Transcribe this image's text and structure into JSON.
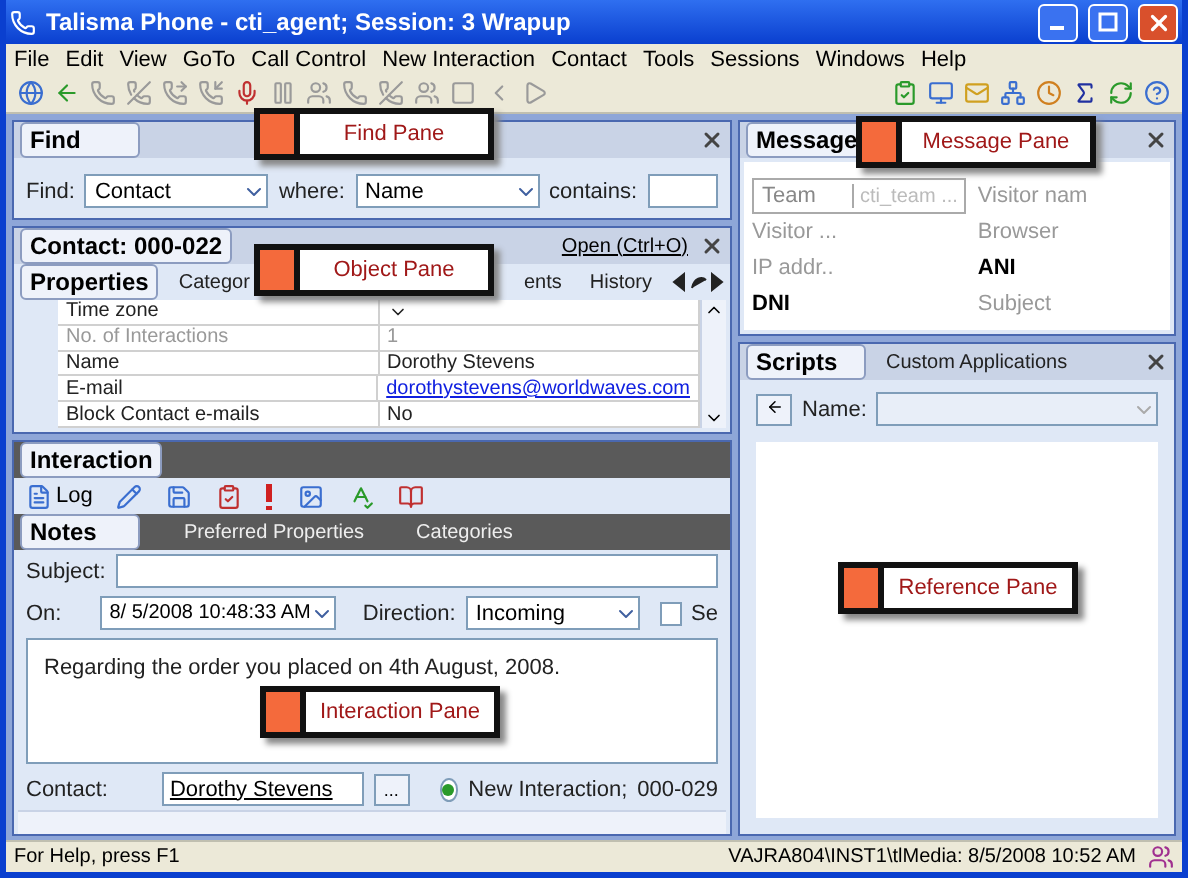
{
  "window": {
    "title": "Talisma Phone - cti_agent; Session: 3 Wrapup"
  },
  "menu": [
    "File",
    "Edit",
    "View",
    "GoTo",
    "Call Control",
    "New Interaction",
    "Contact",
    "Tools",
    "Sessions",
    "Windows",
    "Help"
  ],
  "find_pane": {
    "title": "Find",
    "find_label": "Find:",
    "find_value": "Contact",
    "where_label": "where:",
    "where_value": "Name",
    "contains_label": "contains:"
  },
  "object_pane": {
    "title": "Contact: 000-022",
    "open_link": "Open (Ctrl+O)",
    "tabs": [
      {
        "label": "Properties",
        "selected": true
      },
      {
        "label": "Categor",
        "selected": false
      },
      {
        "label": "ents",
        "selected": false
      },
      {
        "label": "History",
        "selected": false
      }
    ],
    "rows": [
      {
        "name": "Time zone",
        "value": "",
        "kind": "dropdown",
        "disabled": false
      },
      {
        "name": "No. of Interactions",
        "value": "1",
        "kind": "text",
        "disabled": true
      },
      {
        "name": "Name",
        "value": "Dorothy Stevens",
        "kind": "text",
        "disabled": false
      },
      {
        "name": "E-mail",
        "value": "dorothystevens@worldwaves.com",
        "kind": "link",
        "disabled": false
      },
      {
        "name": "Block Contact e-mails",
        "value": "No",
        "kind": "text",
        "disabled": false
      }
    ]
  },
  "interaction_pane": {
    "title": "Interaction",
    "log_label": "Log",
    "tabs": [
      {
        "label": "Notes",
        "selected": true
      },
      {
        "label": "Preferred Properties",
        "selected": false
      },
      {
        "label": "Categories",
        "selected": false
      }
    ],
    "subject_label": "Subject:",
    "on_label": "On:",
    "on_value": "8/ 5/2008 10:48:33 AM",
    "direction_label": "Direction:",
    "direction_value": "Incoming",
    "send_checkbox": {
      "label": "Se",
      "checked": false
    },
    "notes": "Regarding the order you placed on 4th August, 2008.",
    "contact_label": "Contact:",
    "contact_value": "Dorothy Stevens",
    "browse_label": "...",
    "new_interaction": {
      "label": "New Interaction;",
      "selected": true
    },
    "interaction_id": "000-029"
  },
  "message_pane": {
    "title": "Message",
    "team": {
      "label": "Team",
      "placeholder": "cti_team ..."
    },
    "fields": [
      {
        "label": "Visitor nam",
        "bold": false
      },
      {
        "label": "Visitor ...",
        "bold": false
      },
      {
        "label": "Browser",
        "bold": false
      },
      {
        "label": "IP addr..",
        "bold": false
      },
      {
        "label": "ANI",
        "bold": true
      },
      {
        "label": "DNI",
        "bold": true
      },
      {
        "label": "Subject",
        "bold": false
      }
    ]
  },
  "scripts_pane": {
    "tabs": [
      {
        "label": "Scripts",
        "selected": true
      },
      {
        "label": "Custom Applications",
        "selected": false
      }
    ],
    "name_label": "Name:"
  },
  "callouts": [
    {
      "label": "Find Pane"
    },
    {
      "label": "Message Pane"
    },
    {
      "label": "Object Pane"
    },
    {
      "label": "Reference Pane"
    },
    {
      "label": "Interaction Pane"
    }
  ],
  "status_bar": {
    "help": "For Help, press F1",
    "server": "VAJRA804\\INST1\\tlMedia: 8/5/2008 10:52 AM"
  }
}
